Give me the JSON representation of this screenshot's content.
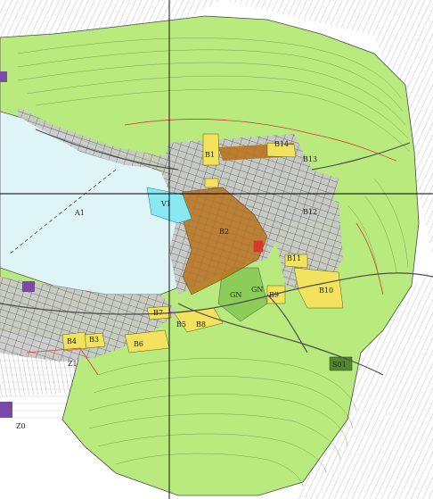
{
  "map": {
    "colors": {
      "background": "#ffffff",
      "lake": "#dff4f6",
      "grass": "#b9ea7d",
      "grass_dark": "#8ccd5a",
      "urban_brown": "#b8741f",
      "residential_yellow": "#f2e25e",
      "street_grey": "#6e6e6e",
      "contour_grey": "#777777",
      "cyan_zone": "#8ae8f2",
      "purple_zone": "#7b4aa8",
      "red_boundary": "#d63a2a",
      "crosshair": "#000000"
    },
    "zone_labels": [
      {
        "id": "b14",
        "text": "B14"
      },
      {
        "id": "b13",
        "text": "B13"
      },
      {
        "id": "b2",
        "text": "B2"
      },
      {
        "id": "v1",
        "text": "V1"
      },
      {
        "id": "a1",
        "text": "A1"
      },
      {
        "id": "b12",
        "text": "B12"
      },
      {
        "id": "b11",
        "text": "B11"
      },
      {
        "id": "b10",
        "text": "B10"
      },
      {
        "id": "gn1",
        "text": "GN"
      },
      {
        "id": "gn2",
        "text": "GN"
      },
      {
        "id": "b9",
        "text": "B9"
      },
      {
        "id": "b8",
        "text": "B8"
      },
      {
        "id": "b7",
        "text": "B7"
      },
      {
        "id": "b6",
        "text": "B6"
      },
      {
        "id": "b5",
        "text": "B5"
      },
      {
        "id": "b4",
        "text": "B4"
      },
      {
        "id": "b3",
        "text": "B3"
      },
      {
        "id": "b1",
        "text": "B1"
      },
      {
        "id": "z1",
        "text": "Z1"
      },
      {
        "id": "z0",
        "text": "Z0"
      },
      {
        "id": "s01",
        "text": "S01"
      }
    ]
  }
}
